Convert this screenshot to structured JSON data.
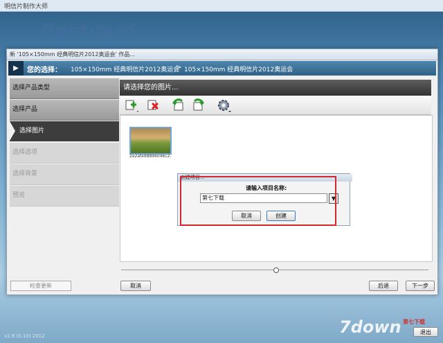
{
  "app": {
    "title": "明信片制作大师",
    "brand": "Postcard",
    "version": "v2.8 (0.10) 2012"
  },
  "dialog": {
    "title": "新 '105×150mm 经典明信片2012奥运会' 作品..."
  },
  "breadcrumb": {
    "label": "您的选择：",
    "step1": "105×150mm 经典明信片2012奥运会",
    "separator": ">",
    "step2": "105×150mm 经典明信片2012奥运会"
  },
  "sidebar": {
    "items": [
      {
        "label": "选择产品类型",
        "state": "done"
      },
      {
        "label": "选择产品",
        "state": "done"
      },
      {
        "label": "选择图片",
        "state": "active"
      },
      {
        "label": "选择选项",
        "state": "todo"
      },
      {
        "label": "选择背景",
        "state": "todo"
      },
      {
        "label": "预览",
        "state": "todo"
      }
    ],
    "check_update": "检查更新"
  },
  "main": {
    "heading": "请选择您的图片...",
    "toolbar": [
      "add-image-icon",
      "delete-image-icon",
      "rotate-left-icon",
      "rotate-right-icon",
      "settings-gear-icon"
    ],
    "thumbnail_caption": "2e2afe98896046c2..."
  },
  "footer": {
    "cancel": "取消",
    "back": "后退",
    "next": "下一步"
  },
  "modal": {
    "title": "创建项目...",
    "prompt": "请输入项目名称:",
    "value": "第七下载",
    "cancel": "取消",
    "create": "创建"
  },
  "watermark": {
    "text": "7down",
    "cn": "第七下载",
    "exit": "退出"
  },
  "colors": {
    "accent": "#2f6188",
    "highlight": "#d0262c"
  }
}
